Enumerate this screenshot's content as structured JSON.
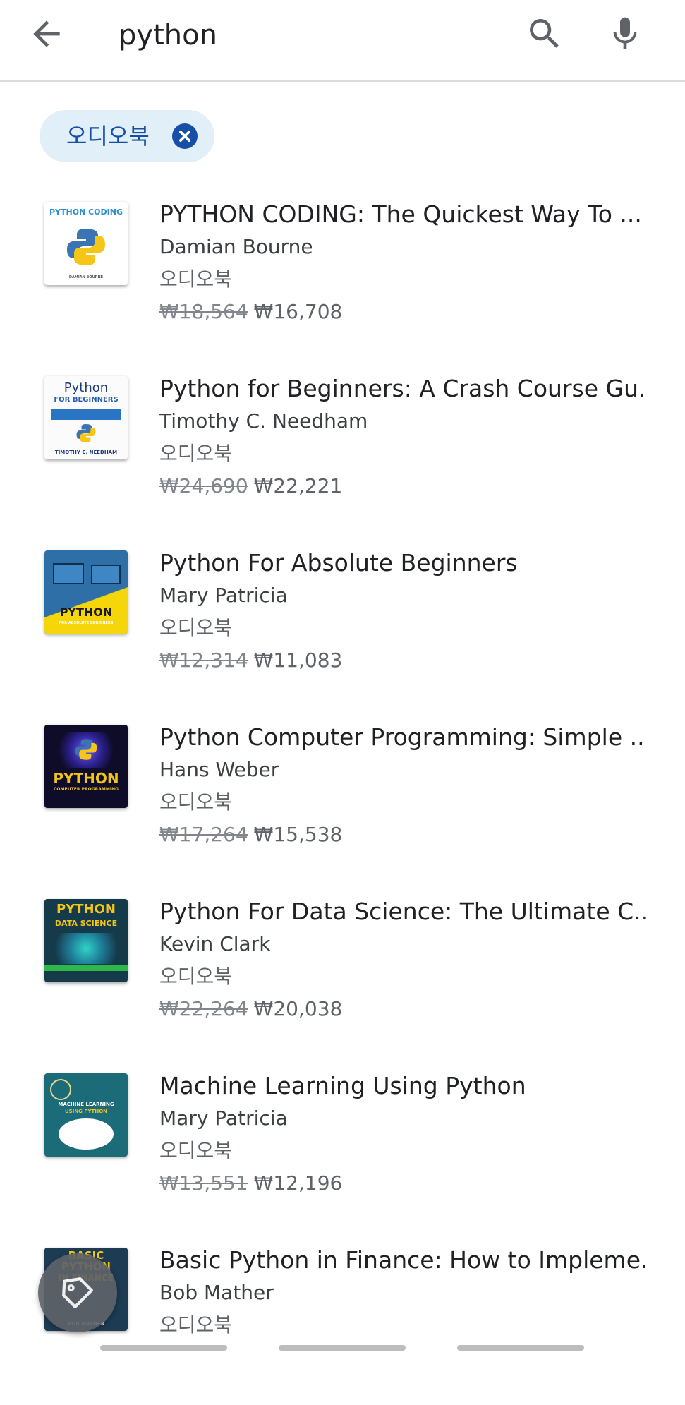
{
  "search": {
    "query": "python",
    "back_icon": "arrow-back-icon",
    "search_icon": "search-icon",
    "mic_icon": "mic-icon"
  },
  "filter_chip": {
    "label": "오디오북",
    "close_icon": "close-circle-icon"
  },
  "results": [
    {
      "title": "PYTHON CODING: The Quickest Way To ...",
      "author": "Damian Bourne",
      "format": "오디오북",
      "old_price": "₩18,564",
      "price": "₩16,708",
      "cover": {
        "line1": "PYTHON CODING",
        "line2": "DAMIAN BOURNE"
      }
    },
    {
      "title": "Python for Beginners: A Crash Course Gu...",
      "author": "Timothy C. Needham",
      "format": "오디오북",
      "old_price": "₩24,690",
      "price": "₩22,221",
      "cover": {
        "line1": "Python",
        "line2": "FOR BEGINNERS",
        "line3": "TIMOTHY C. NEEDHAM"
      }
    },
    {
      "title": "Python For Absolute Beginners",
      "author": "Mary Patricia",
      "format": "오디오북",
      "old_price": "₩12,314",
      "price": "₩11,083",
      "cover": {
        "line1": "PYTHON",
        "line2": "FOR ABSOLUTE BEGINNERS"
      }
    },
    {
      "title": "Python Computer Programming: Simple ...",
      "author": "Hans Weber",
      "format": "오디오북",
      "old_price": "₩17,264",
      "price": "₩15,538",
      "cover": {
        "line1": "PYTHON",
        "line2": "COMPUTER PROGRAMMING"
      }
    },
    {
      "title": "Python For Data Science: The Ultimate C...",
      "author": "Kevin Clark",
      "format": "오디오북",
      "old_price": "₩22,264",
      "price": "₩20,038",
      "cover": {
        "line1": "PYTHON",
        "line2": "DATA SCIENCE"
      }
    },
    {
      "title": "Machine Learning Using Python",
      "author": "Mary Patricia",
      "format": "오디오북",
      "old_price": "₩13,551",
      "price": "₩12,196",
      "cover": {
        "line1": "MACHINE LEARNING",
        "line2": "USING PYTHON"
      }
    },
    {
      "title": "Basic Python in Finance: How to Impleme...",
      "author": "Bob Mather",
      "format": "오디오북",
      "old_price": "",
      "price": "",
      "cover": {
        "line1": "BASIC",
        "line2": "PYTHON",
        "line3": "IN FINANCE",
        "line4": "BOB MATHER"
      }
    }
  ],
  "fab": {
    "icon": "tag-icon"
  },
  "colors": {
    "chip_bg": "#e1eff9",
    "chip_accent": "#174ea6",
    "divider": "#dadce0"
  }
}
